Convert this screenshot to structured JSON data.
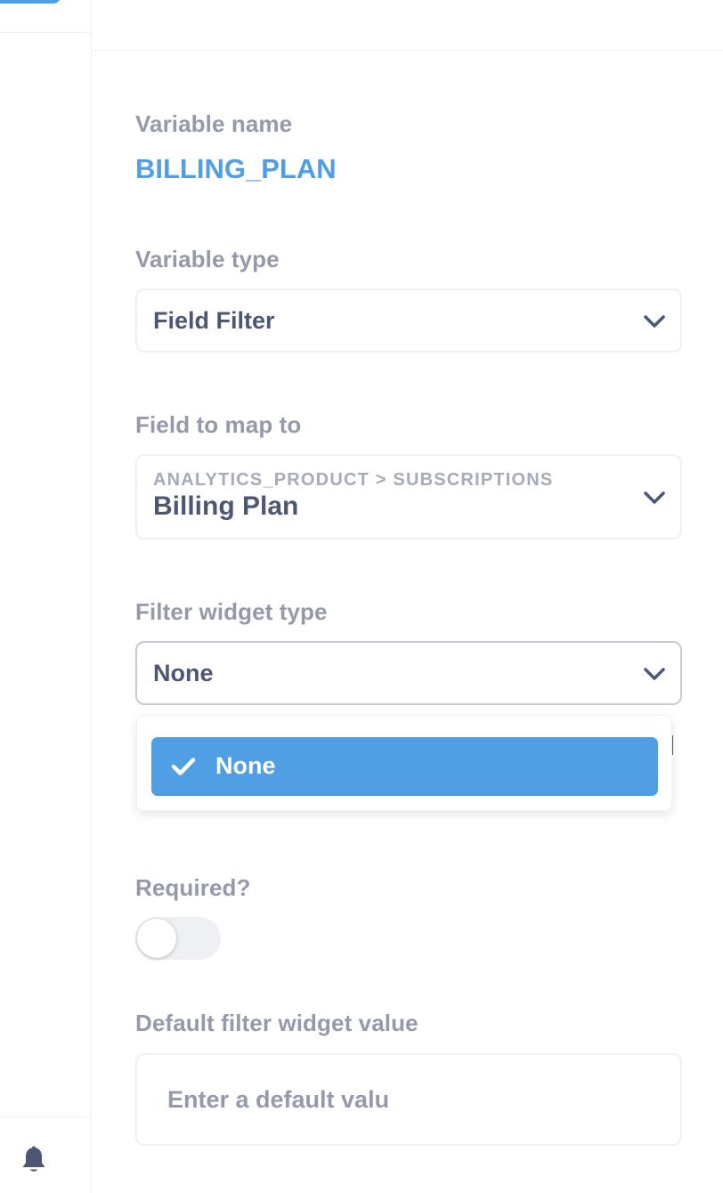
{
  "variable": {
    "name_label": "Variable name",
    "name_value": "BILLING_PLAN"
  },
  "variable_type": {
    "label": "Variable type",
    "selected": "Field Filter"
  },
  "field_map": {
    "label": "Field to map to",
    "breadcrumb": "ANALYTICS_PRODUCT > SUBSCRIPTIONS",
    "selected": "Billing Plan"
  },
  "widget_type": {
    "label": "Filter widget type",
    "selected": "None",
    "options": [
      {
        "label": "None",
        "selected": true
      }
    ]
  },
  "required": {
    "label": "Required?",
    "enabled": false
  },
  "default_value": {
    "label": "Default filter widget value",
    "placeholder": "Enter a default valu",
    "value": ""
  },
  "colors": {
    "accent": "#509ee3",
    "label": "#949aab",
    "text": "#4c5773",
    "border": "#eef0f3"
  },
  "icons": {
    "bell": "bell-icon",
    "chevron": "chevron-down-icon",
    "check": "check-icon"
  }
}
